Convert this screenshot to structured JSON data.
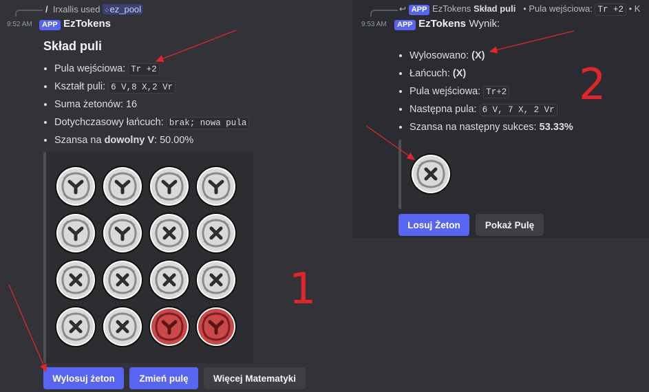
{
  "left": {
    "reply": {
      "command_glyph": "/",
      "user": "Irxallis used",
      "command": "ez_pool"
    },
    "timestamp": "9:52 AM",
    "badge": "APP",
    "bot": "EzTokens",
    "embed_title": "Skład puli",
    "fields": [
      {
        "label": "Pula wejściowa: ",
        "code": "Tr +2"
      },
      {
        "label": "Kształt puli: ",
        "code": "6 V,8 X,2 Vr"
      },
      {
        "label": "Suma żetonów: 16"
      },
      {
        "label": "Dotychczasowy łańcuch: ",
        "code": "brak; nowa pula"
      },
      {
        "label": "Szansa na ",
        "bold": "dowolny V",
        "suffix": ": 50.00%"
      }
    ],
    "tokens": [
      "V",
      "V",
      "V",
      "V",
      "V",
      "V",
      "X",
      "X",
      "X",
      "X",
      "X",
      "X",
      "X",
      "X",
      "Vr",
      "Vr"
    ],
    "buttons": [
      "Wylosuj żeton",
      "Zmień pulę",
      "Więcej Matematyki"
    ],
    "annotation": "1"
  },
  "right": {
    "reply": {
      "bot": "EzTokens",
      "title": "Skład puli",
      "extra": "• Pula wejściowa:",
      "code": "Tr +2",
      "tail": "• K"
    },
    "timestamp": "9:53 AM",
    "badge": "APP",
    "bot": "EzTokens",
    "message": "Wynik:",
    "fields": [
      {
        "label": "Wylosowano: ",
        "bold": "(X)"
      },
      {
        "label": "Łańcuch: ",
        "bold": "(X)"
      },
      {
        "label": "Pula wejściowa: ",
        "code": "Tr+2"
      },
      {
        "label": "Następna pula: ",
        "code": "6 V, 7 X, 2 Vr"
      },
      {
        "label": "Szansa na następny sukces: ",
        "bold": "53.33%"
      }
    ],
    "tokens": [
      "X"
    ],
    "buttons": [
      "Losuj Żeton",
      "Pokaż Pulę"
    ],
    "annotation": "2"
  },
  "colors": {
    "accent": "#5865f2",
    "annotation": "#e0262b",
    "token_silver": "#d9d9d9",
    "token_red": "#c94848"
  },
  "icons": {
    "reply": "reply-arrow-icon",
    "command": "command-icon"
  }
}
